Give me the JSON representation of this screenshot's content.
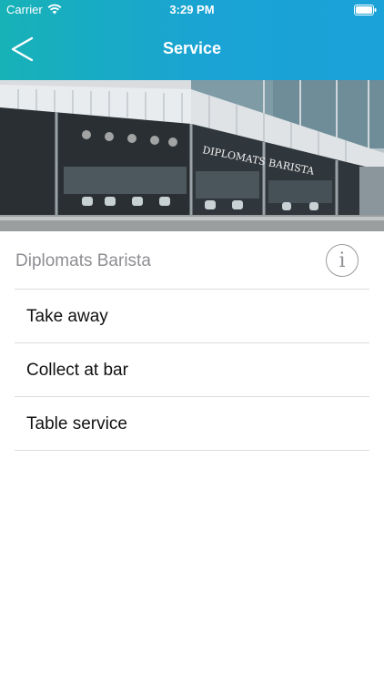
{
  "status_bar": {
    "carrier": "Carrier",
    "time": "3:29 PM",
    "wifi_icon": "wifi-icon",
    "battery_icon": "battery-icon"
  },
  "nav": {
    "title": "Service",
    "back_icon": "chevron-left-icon"
  },
  "hero": {
    "sign_text": "DIPLOMATS BARISTA"
  },
  "venue": {
    "name": "Diplomats Barista",
    "info_icon": "info-icon",
    "info_glyph": "i"
  },
  "options": [
    {
      "label": "Take away"
    },
    {
      "label": "Collect at bar"
    },
    {
      "label": "Table service"
    }
  ],
  "colors": {
    "header_gradient_start": "#17b2b7",
    "header_gradient_end": "#1ba2d9",
    "separator": "#dcdcdc",
    "muted_text": "#8e8e93"
  }
}
